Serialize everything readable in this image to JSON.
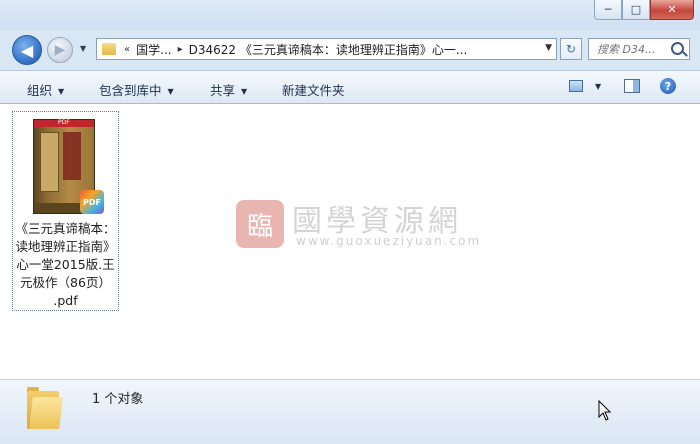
{
  "window": {
    "controls": {
      "minimize": "─",
      "maximize": "□",
      "close": "✕"
    }
  },
  "nav": {
    "back_glyph": "◀",
    "forward_glyph": "▶",
    "history_arrow": "▼",
    "breadcrumb_overflow": "«",
    "breadcrumb_sep": "▸",
    "crumbs": [
      "国学...",
      "D34622 《三元真谛稿本：读地理辨正指南》心一..."
    ],
    "address_dropdown": "▼",
    "refresh_glyph": "↻"
  },
  "search": {
    "placeholder": "搜索 D34..."
  },
  "toolbar": {
    "organize": "组织",
    "include_in_library": "包含到库中",
    "share": "共享",
    "new_folder": "新建文件夹",
    "menu_arrow": "▼",
    "help_glyph": "?"
  },
  "file": {
    "name": "《三元真谛稿本：读地理辨正指南》心一堂2015版.王元极作（86页）.pdf",
    "name_lines": [
      "《三元真谛稿本：",
      "读地理辨正指南》",
      "心一堂2015版.王",
      "元极作（86页）",
      ".pdf"
    ],
    "cover_band": "PDF",
    "badge": "PDF"
  },
  "watermark": {
    "seal": "臨",
    "title": "國學資源網",
    "url": "www.guoxueziyuan.com"
  },
  "details": {
    "count": "1 个对象"
  },
  "colors": {
    "frame": "#d9e6f4",
    "close": "#c4463a",
    "accent": "#2e6ec2"
  }
}
